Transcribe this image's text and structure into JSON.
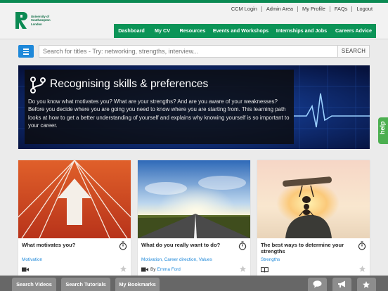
{
  "brand": {
    "logo_lines": [
      "University of",
      "Southampton",
      "London"
    ],
    "green": "#0b9457",
    "blue": "#1e88d9"
  },
  "toplinks": [
    "CCM Login",
    "Admin Area",
    "My Profile",
    "FAQs",
    "Logout"
  ],
  "nav": [
    "Dashboard",
    "My CV",
    "Resources",
    "Events and Workshops",
    "Internships and Jobs",
    "Careers Advice"
  ],
  "search": {
    "placeholder": "Search for titles - Try: networking, strengths, interview...",
    "button": "SEARCH"
  },
  "hero": {
    "title": "Recognising skills & preferences",
    "body": "Do you know what motivates you? What are your strengths? And are you aware of your weaknesses? Before you decide where you are going you need to know where you are starting from. This learning path looks at how to get a better understanding of yourself and explains why knowing yourself is so important to your career.",
    "icon": "branch-icon"
  },
  "help": "help",
  "cards": [
    {
      "title": "What motivates you?",
      "categories": "Motivation",
      "by": "",
      "author": "",
      "media": "video-icon"
    },
    {
      "title": "What do you really want to do?",
      "categories": "Motivation, Career direction, Values",
      "by": "By",
      "author": "Emma Ford",
      "media": "video-icon"
    },
    {
      "title": "The best ways to determine your strengths",
      "categories": "Strengths",
      "by": "",
      "author": "",
      "media": "book-icon"
    }
  ],
  "bottombar": {
    "search_videos": "Search Videos",
    "search_tutorials": "Search Tutorials",
    "bookmarks": "My Bookmarks",
    "icons": [
      "chat-icon",
      "megaphone-icon",
      "star-icon"
    ]
  }
}
